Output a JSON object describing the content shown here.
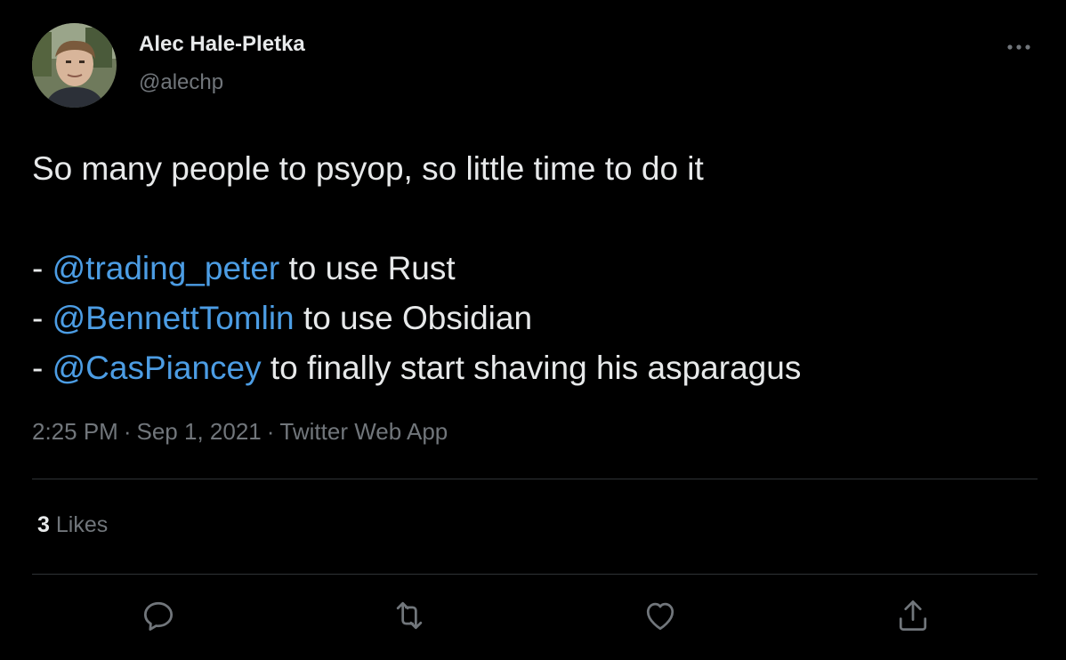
{
  "author": {
    "name": "Alec Hale-Pletka",
    "handle": "@alechp"
  },
  "tweet": {
    "line1": "So many people to psyop, so little time to do it",
    "items": [
      {
        "prefix": "- ",
        "mention": "@trading_peter",
        "rest": " to use Rust"
      },
      {
        "prefix": "- ",
        "mention": "@BennettTomlin",
        "rest": " to use Obsidian"
      },
      {
        "prefix": "- ",
        "mention": "@CasPiancey",
        "rest": " to finally start shaving his asparagus"
      }
    ]
  },
  "meta": {
    "time": "2:25 PM",
    "separator": "·",
    "date": "Sep 1, 2021",
    "source": "Twitter Web App"
  },
  "stats": {
    "likes_count": "3",
    "likes_label": "Likes"
  },
  "icons": {
    "more": "more-icon",
    "reply": "reply-icon",
    "retweet": "retweet-icon",
    "like": "heart-icon",
    "share": "share-icon"
  },
  "colors": {
    "background": "#000000",
    "text": "#e7e9ea",
    "secondary": "#71767b",
    "link": "#4c9de4",
    "divider": "#2f3336"
  }
}
